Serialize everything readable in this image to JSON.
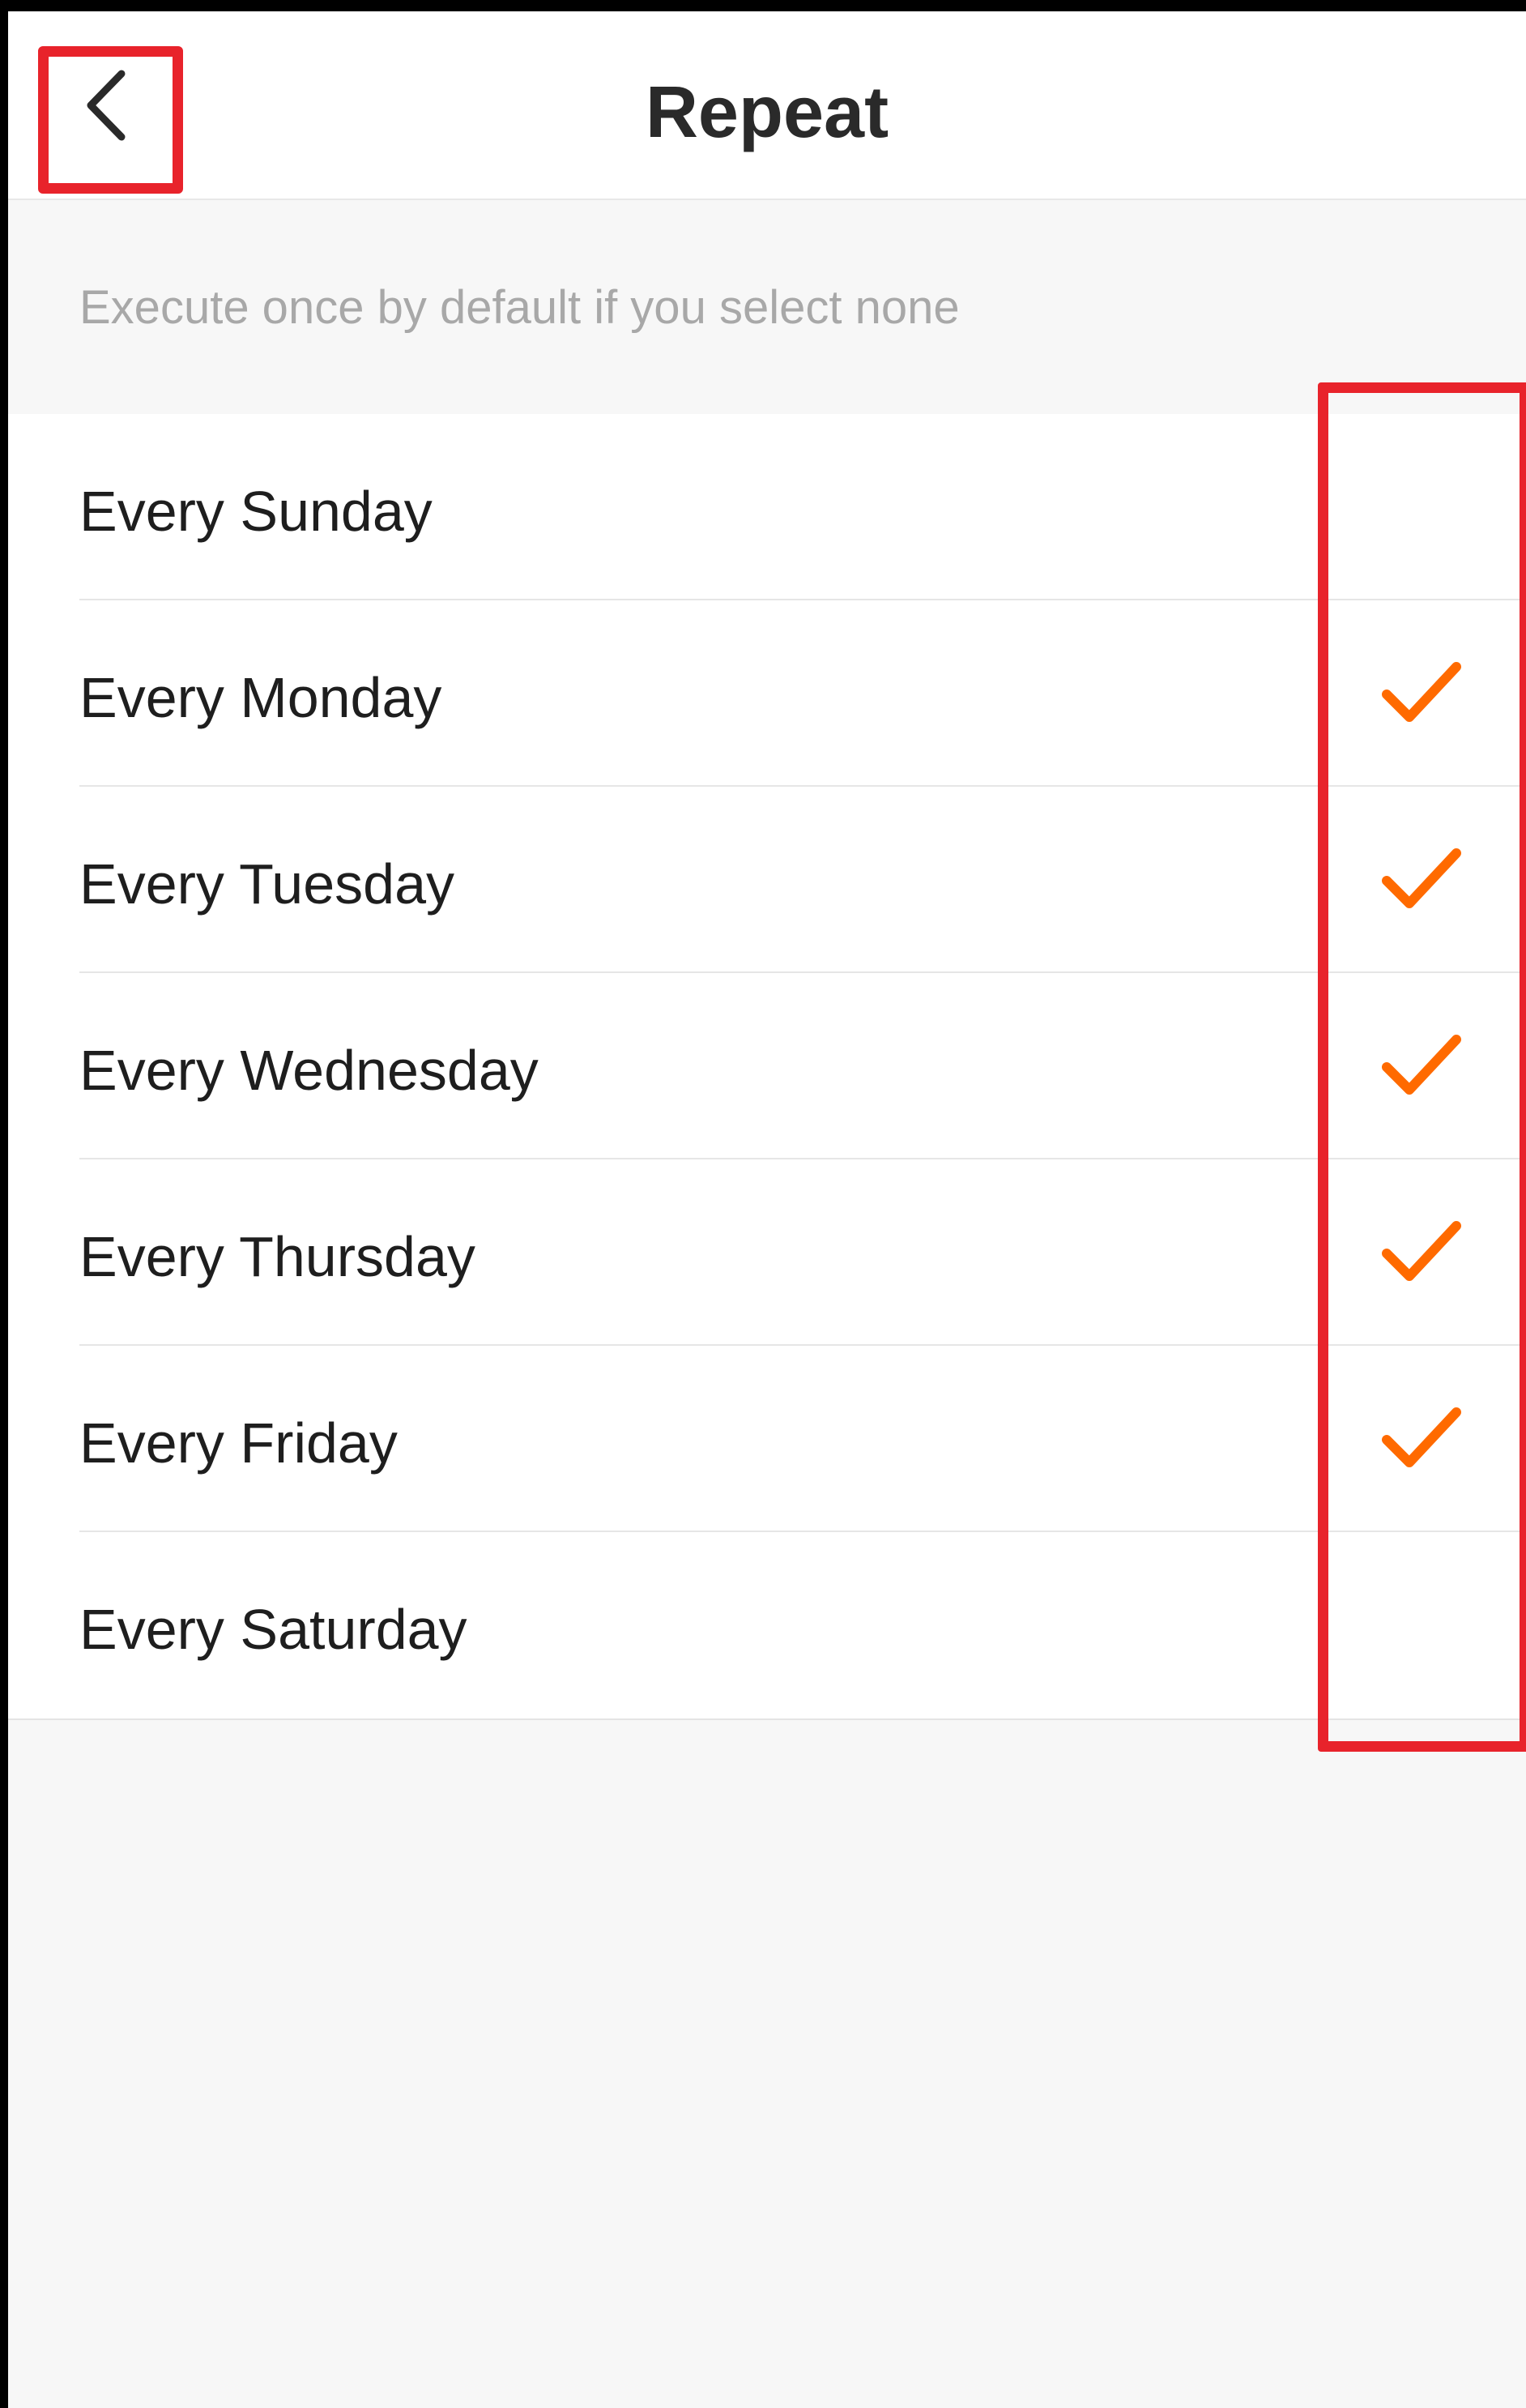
{
  "header": {
    "title": "Repeat",
    "back_icon": "chevron-left-icon"
  },
  "hint": "Execute once by default if you select none",
  "days": [
    {
      "label": "Every Sunday",
      "checked": false
    },
    {
      "label": "Every Monday",
      "checked": true
    },
    {
      "label": "Every Tuesday",
      "checked": true
    },
    {
      "label": "Every Wednesday",
      "checked": true
    },
    {
      "label": "Every Thursday",
      "checked": true
    },
    {
      "label": "Every Friday",
      "checked": true
    },
    {
      "label": "Every Saturday",
      "checked": false
    }
  ],
  "colors": {
    "accent": "#ff6a00",
    "highlight": "#e8232b",
    "text": "#1e1e1e",
    "hint_text": "#a8a8a8",
    "background": "#f7f7f7"
  }
}
